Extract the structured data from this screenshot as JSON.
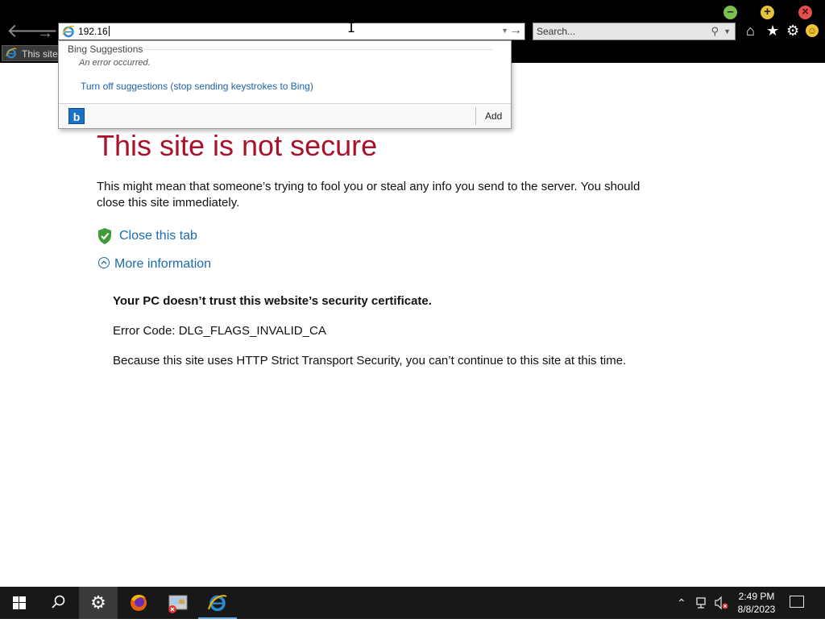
{
  "browser": {
    "address": {
      "value": "192.16"
    },
    "search": {
      "placeholder": "Search..."
    },
    "tab": {
      "label": "This site"
    }
  },
  "suggestions": {
    "header": "Bing Suggestions",
    "error": "An error occurred.",
    "turn_off": "Turn off suggestions (stop sending keystrokes to Bing)",
    "provider_icon": "bing-icon",
    "add_label": "Add"
  },
  "page": {
    "title": "This site is not secure",
    "description": "This might mean that someone’s trying to fool you or steal any info you send to the server. You should close this site immediately.",
    "close_tab": "Close this tab",
    "more_info": "More information",
    "cert_heading": "Your PC doesn’t trust this website’s security certificate.",
    "error_code": "Error Code: DLG_FLAGS_INVALID_CA",
    "hsts": "Because this site uses HTTP Strict Transport Security, you can’t continue to this site at this time."
  },
  "taskbar": {
    "clock": {
      "time": "2:49 PM",
      "date": "8/8/2023"
    }
  },
  "colors": {
    "title_red": "#a8122a",
    "link_blue": "#1c6bad",
    "chrome_black": "#000000"
  }
}
